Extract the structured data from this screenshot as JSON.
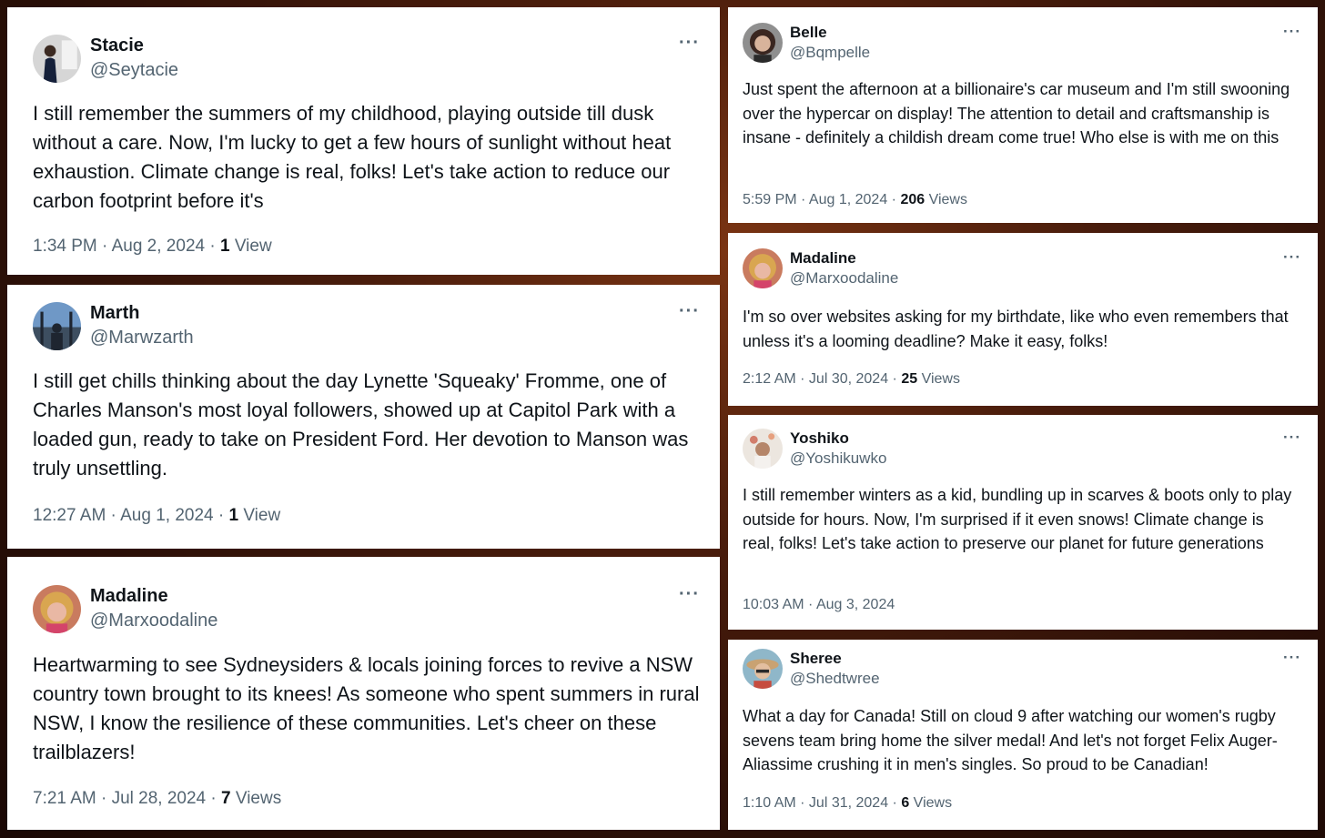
{
  "posts": [
    {
      "name": "Stacie",
      "handle": "@Seytacie",
      "text": "I still remember the summers of my childhood, playing outside till dusk without a care. Now, I'm lucky to get a few hours of sunlight without heat exhaustion. Climate change is real, folks! Let's take action to reduce our carbon footprint before it's",
      "time": "1:34 PM · Aug 2, 2024 · ",
      "views_count": "1",
      "views_label": " View",
      "more": "···",
      "avatar_colors": [
        "#dcdcdc",
        "#1b2233"
      ]
    },
    {
      "name": "Marth",
      "handle": "@Marwzarth",
      "text": "I still get chills thinking about the day Lynette 'Squeaky' Fromme, one of Charles Manson's most loyal followers, showed up at Capitol Park with a loaded gun, ready to take on President Ford. Her devotion to Manson was truly unsettling.",
      "time": "12:27 AM · Aug 1, 2024 · ",
      "views_count": "1",
      "views_label": " View",
      "more": "···",
      "avatar_colors": [
        "#6f98c6",
        "#1e2530"
      ]
    },
    {
      "name": "Madaline",
      "handle": "@Marxoodaline",
      "text": "Heartwarming to see Sydneysiders & locals joining forces to revive a NSW country town brought to its knees! As someone who spent summers in rural NSW, I know the resilience of these communities. Let's cheer on these trailblazers!",
      "time": "7:21 AM · Jul 28, 2024 · ",
      "views_count": "7",
      "views_label": " Views",
      "more": "···",
      "avatar_colors": [
        "#d9a650",
        "#e9b8a4"
      ]
    },
    {
      "name": "Belle",
      "handle": "@Bqmpelle",
      "text": "Just spent the afternoon at a billionaire's car museum and I'm still swooning over the hypercar on display! The attention to detail and craftsmanship is insane - definitely a childish dream come true! Who else is with me on this",
      "time": "5:59 PM · Aug 1, 2024 · ",
      "views_count": "206",
      "views_label": " Views",
      "more": "···",
      "avatar_colors": [
        "#3a2620",
        "#d8b39b"
      ]
    },
    {
      "name": "Madaline",
      "handle": "@Marxoodaline",
      "text": "I'm so over websites asking for my birthdate, like who even remembers that unless it's a looming deadline? Make it easy, folks!",
      "time": "2:12 AM · Jul 30, 2024 · ",
      "views_count": "25",
      "views_label": " Views",
      "more": "···",
      "avatar_colors": [
        "#d9a650",
        "#e9b8a4"
      ]
    },
    {
      "name": "Yoshiko",
      "handle": "@Yoshikuwko",
      "text": "I still remember winters as a kid, bundling up in scarves & boots only to play outside for hours. Now, I'm surprised if it even snows! Climate change is real, folks! Let's take action to preserve our planet for future generations",
      "time": "10:03 AM · Aug 3, 2024",
      "views_count": "",
      "views_label": "",
      "more": "···",
      "avatar_colors": [
        "#ece6df",
        "#b5866a"
      ]
    },
    {
      "name": "Sheree",
      "handle": "@Shedtwree",
      "text": "What a day for Canada! Still on cloud 9 after watching our women's rugby sevens team bring home the silver medal! And let's not forget Felix Auger-Aliassime crushing it in men's singles. So proud to be Canadian!",
      "time": "1:10 AM · Jul 31, 2024 · ",
      "views_count": "6",
      "views_label": " Views",
      "more": "···",
      "avatar_colors": [
        "#c9a272",
        "#e3bfa0"
      ]
    }
  ]
}
